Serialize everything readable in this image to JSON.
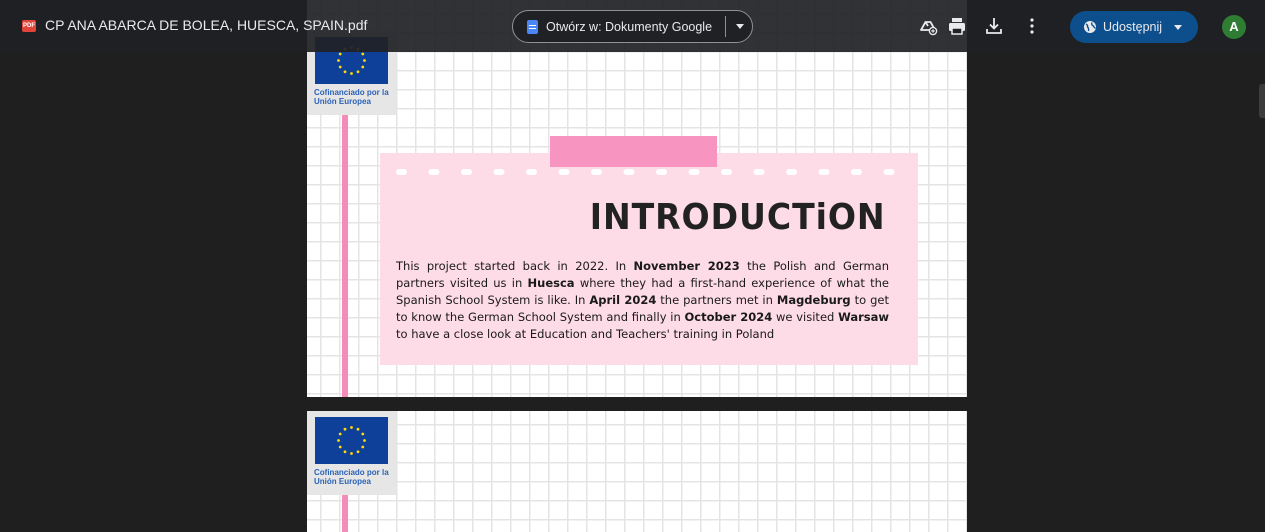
{
  "toolbar": {
    "file_badge": "PDF",
    "file_title": "CP ANA ABARCA DE BOLEA, HUESCA, SPAIN.pdf",
    "open_with_label": "Otwórz w: Dokumenty Google",
    "share_label": "Udostępnij",
    "avatar_letter": "A"
  },
  "icons": [
    "pdf-icon",
    "docs-icon",
    "add-to-drive-icon",
    "print-icon",
    "download-icon",
    "more-icon",
    "globe-icon"
  ],
  "pages": [
    {
      "eu_text": "Cofinanciado por la Unión Europea",
      "title": "INTRODUCTiON",
      "body": [
        {
          "t": "This project started back in 2022. In ",
          "b": false
        },
        {
          "t": "November 2023",
          "b": true
        },
        {
          "t": " the Polish and German partners visited us in ",
          "b": false
        },
        {
          "t": "Huesca",
          "b": true
        },
        {
          "t": " where they had a first-hand experience of what the Spanish School System is like. In ",
          "b": false
        },
        {
          "t": "April 2024",
          "b": true
        },
        {
          "t": " the partners met in ",
          "b": false
        },
        {
          "t": "Magdeburg",
          "b": true
        },
        {
          "t": " to get to know the German School System and finally in ",
          "b": false
        },
        {
          "t": "October 2024",
          "b": true
        },
        {
          "t": " we visited ",
          "b": false
        },
        {
          "t": "Warsaw",
          "b": true
        },
        {
          "t": " to have a close look at Education and Teachers' training in Poland",
          "b": false
        }
      ]
    },
    {
      "eu_text": "Cofinanciado por la Unión Europea"
    }
  ],
  "colors": {
    "accent_pink": "#f794bf",
    "card_pink": "#fddbe7",
    "share_blue": "#0d4f8c",
    "avatar_green": "#2e7d32"
  }
}
